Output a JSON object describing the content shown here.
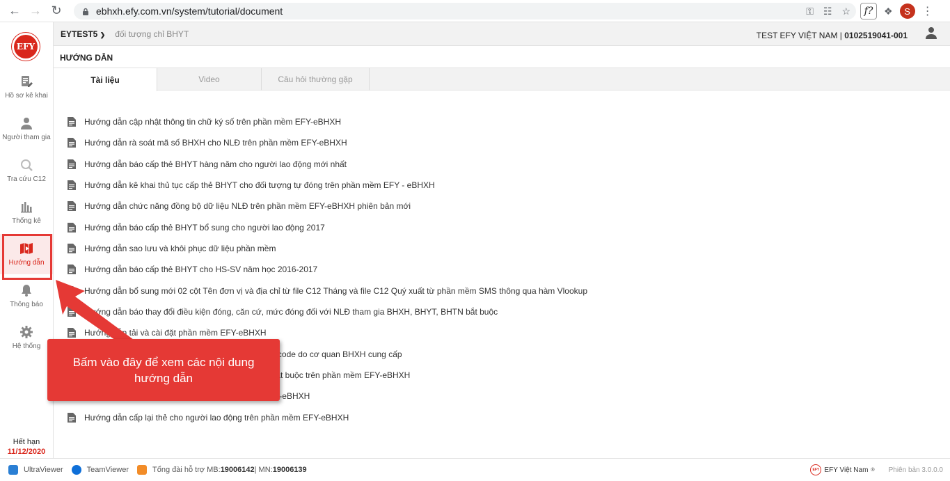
{
  "browser": {
    "url": "ebhxh.efy.com.vn/system/tutorial/document",
    "profile_initial": "S",
    "ext_label": "f?"
  },
  "brand": {
    "logo_text": "EFY",
    "accent": "#d9271c"
  },
  "sidebar": {
    "items": [
      {
        "label": "Hồ sơ kê khai",
        "icon": "edit-document-icon"
      },
      {
        "label": "Người tham gia",
        "icon": "person-icon"
      },
      {
        "label": "Tra cứu C12",
        "icon": "search-icon"
      },
      {
        "label": "Thống kê",
        "icon": "bar-chart-icon"
      },
      {
        "label": "Hướng dẫn",
        "icon": "book-icon",
        "active": true
      },
      {
        "label": "Thông báo",
        "icon": "bell-icon"
      },
      {
        "label": "Hệ thống",
        "icon": "gear-icon"
      }
    ],
    "expire_label": "Hết hạn",
    "expire_date": "11/12/2020"
  },
  "topbar": {
    "org_code": "EYTEST5",
    "org_sub": "đối tượng chỉ BHYT",
    "company_name": "TEST EFY VIỆT NAM | ",
    "company_code": "0102519041-001"
  },
  "page_title": "HƯỚNG DẪN",
  "tabs": [
    {
      "label": "Tài liệu",
      "active": true
    },
    {
      "label": "Video",
      "active": false
    },
    {
      "label": "Câu hỏi thường gặp",
      "active": false
    }
  ],
  "documents": [
    "Hướng dẫn cập nhật thông tin chữ ký số trên phần mềm EFY-eBHXH",
    "Hướng dẫn rà soát mã số BHXH cho NLĐ trên phần mềm EFY-eBHXH",
    "Hướng dẫn báo cấp thẻ BHYT hàng năm cho người lao động mới nhất",
    "Hướng dẫn kê khai thủ tục cấp thẻ BHYT cho đối tượng tự đóng trên phần mềm EFY - eBHXH",
    "Hướng dẫn chức năng đồng bộ dữ liệu NLĐ trên phần mềm EFY-eBHXH phiên bản mới",
    "Hướng dẫn báo cấp thẻ BHYT bổ sung cho người lao động 2017",
    "Hướng dẫn sao lưu và khôi phục dữ liệu phần mềm",
    "Hướng dẫn báo cấp thẻ BHYT cho HS-SV năm học 2016-2017",
    "Hướng dẫn bổ sung mới 02 cột Tên đơn vị và địa chỉ từ file C12 Tháng và file C12 Quý xuất từ phần mềm SMS thông qua hàm Vlookup",
    "Hướng dẫn báo thay đổi điều kiện đóng, căn cứ, mức đóng đối với NLĐ tham gia BHXH, BHYT, BHTN bắt buộc",
    "Hướng dẫn tải và cài đặt phần mềm EFY-eBHXH",
    "Hướng dẫn chuyển đổi font chữ từ TCVN3 sang Unicode do cơ quan BHXH cung cấp",
    "Hướng dẫn kê khai tham gia BHXH, BHYT, BHTN bắt buộc trên phần mềm EFY-eBHXH",
    "Hướng dẫn cập nhật phần mềm trên phần mềm EFY-eBHXH",
    "Hướng dẫn cấp lại thẻ cho người lao động trên phần mềm EFY-eBHXH"
  ],
  "callout": {
    "text": "Bấm vào đây để xem các nội dung hướng dẫn"
  },
  "footer": {
    "ultraviewer": "UltraViewer",
    "teamviewer": "TeamViewer",
    "hotline_prefix": "Tổng đài hỗ trợ MB: ",
    "hotline_mb": "19006142",
    "hotline_sep": " | MN: ",
    "hotline_mn": "19006139",
    "brand": "EFY Việt Nam",
    "version": "Phiên bản 3.0.0.0"
  }
}
